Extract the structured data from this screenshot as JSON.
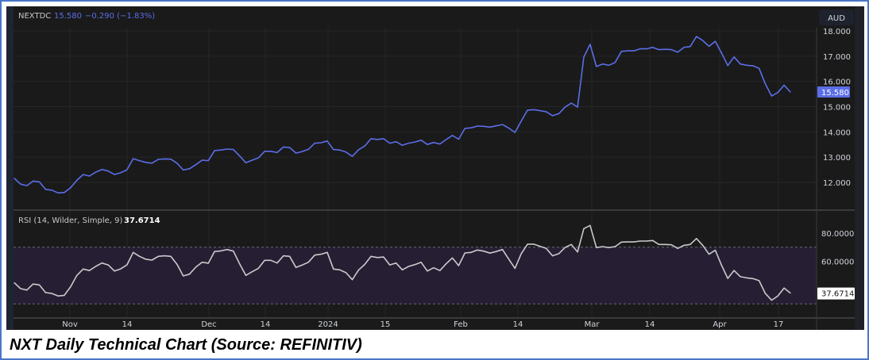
{
  "legend": {
    "symbol": "NEXTDC",
    "last": "15.580",
    "change": "−0.290 (−1.83%)",
    "rsi_label": "RSI (14, Wilder, Simple, 9)",
    "rsi_value": "37.6714"
  },
  "currency_button": "AUD",
  "caption": "NXT Daily Technical Chart (Source: REFINITIV)",
  "colors": {
    "price": "#5b6ee8",
    "rsi": "#c9c9cc",
    "band": "#261f33",
    "background": "#1a1a1a"
  },
  "chart_data": [
    {
      "type": "line",
      "title": "NEXTDC",
      "ylabel": "AUD",
      "ylim": [
        11.5,
        18.2
      ],
      "y_ticks": [
        "18.000",
        "17.000",
        "16.000",
        "15.000",
        "14.000",
        "13.000",
        "12.000"
      ],
      "y_tick_values": [
        18,
        17,
        16,
        15,
        14,
        13,
        12
      ],
      "last_value_label": "15.580",
      "x_ticks": [
        "Nov",
        "14",
        "Dec",
        "14",
        "2024",
        "15",
        "Feb",
        "14",
        "Mar",
        "14",
        "Apr",
        "17"
      ],
      "grid": true,
      "series": [
        {
          "name": "NEXTDC close",
          "values": [
            12.16,
            11.93,
            11.87,
            12.05,
            12.02,
            11.72,
            11.69,
            11.58,
            11.6,
            11.79,
            12.08,
            12.31,
            12.25,
            12.4,
            12.51,
            12.45,
            12.31,
            12.38,
            12.5,
            12.94,
            12.86,
            12.79,
            12.76,
            12.91,
            12.93,
            12.92,
            12.76,
            12.49,
            12.54,
            12.7,
            12.88,
            12.86,
            13.26,
            13.28,
            13.32,
            13.3,
            13.05,
            12.78,
            12.88,
            12.97,
            13.23,
            13.23,
            13.18,
            13.4,
            13.38,
            13.16,
            13.22,
            13.31,
            13.55,
            13.57,
            13.64,
            13.3,
            13.28,
            13.2,
            13.03,
            13.29,
            13.44,
            13.73,
            13.7,
            13.73,
            13.55,
            13.61,
            13.47,
            13.55,
            13.6,
            13.67,
            13.5,
            13.58,
            13.52,
            13.7,
            13.86,
            13.71,
            14.14,
            14.16,
            14.23,
            14.22,
            14.19,
            14.24,
            14.29,
            14.15,
            13.98,
            14.43,
            14.86,
            14.88,
            14.84,
            14.8,
            14.64,
            14.72,
            14.98,
            15.14,
            14.98,
            16.97,
            17.47,
            16.59,
            16.69,
            16.64,
            16.75,
            17.19,
            17.21,
            17.21,
            17.29,
            17.29,
            17.35,
            17.26,
            17.27,
            17.26,
            17.16,
            17.35,
            17.38,
            17.78,
            17.62,
            17.39,
            17.59,
            17.13,
            16.63,
            16.97,
            16.69,
            16.64,
            16.62,
            16.52,
            15.9,
            15.42,
            15.56,
            15.85,
            15.58
          ]
        }
      ]
    },
    {
      "type": "line",
      "title": "RSI (14, Wilder, Simple, 9)",
      "ylim": [
        20,
        90
      ],
      "y_ticks": [
        "80.0000",
        "60.0000"
      ],
      "y_tick_values": [
        80,
        60
      ],
      "bands": [
        30,
        70
      ],
      "last_value_label": "37.6714",
      "series": [
        {
          "name": "RSI",
          "values": [
            44.9,
            40.8,
            39.8,
            44.0,
            43.4,
            38.0,
            37.4,
            35.6,
            36.1,
            42.1,
            50.1,
            54.6,
            53.5,
            56.4,
            58.8,
            57.5,
            53.2,
            54.7,
            57.5,
            66.3,
            63.5,
            61.5,
            60.9,
            63.5,
            63.9,
            63.5,
            57.9,
            49.7,
            51.0,
            55.9,
            59.4,
            58.7,
            66.9,
            67.4,
            68.3,
            67.2,
            58.3,
            50.1,
            52.7,
            55.1,
            60.7,
            60.7,
            58.8,
            63.9,
            63.5,
            55.7,
            57.4,
            59.4,
            64.4,
            65.0,
            66.3,
            54.6,
            54.0,
            52.0,
            47.1,
            53.8,
            57.9,
            63.5,
            62.7,
            63.1,
            57.5,
            58.8,
            54.0,
            56.4,
            57.7,
            59.4,
            53.2,
            55.5,
            53.5,
            58.3,
            62.4,
            57.0,
            65.9,
            66.3,
            68.0,
            67.2,
            65.8,
            66.9,
            68.3,
            61.6,
            55.1,
            65.4,
            72.1,
            72.1,
            70.6,
            69.1,
            63.9,
            65.4,
            69.8,
            71.9,
            66.6,
            83.1,
            85.3,
            69.7,
            70.4,
            69.7,
            70.4,
            73.6,
            73.7,
            73.7,
            74.3,
            74.3,
            74.7,
            71.9,
            71.9,
            71.7,
            69.1,
            71.3,
            71.9,
            76.1,
            71.3,
            65.0,
            67.8,
            57.4,
            48.0,
            53.6,
            49.2,
            48.4,
            47.9,
            46.4,
            37.4,
            32.6,
            35.6,
            41.2,
            37.67
          ]
        }
      ]
    }
  ]
}
